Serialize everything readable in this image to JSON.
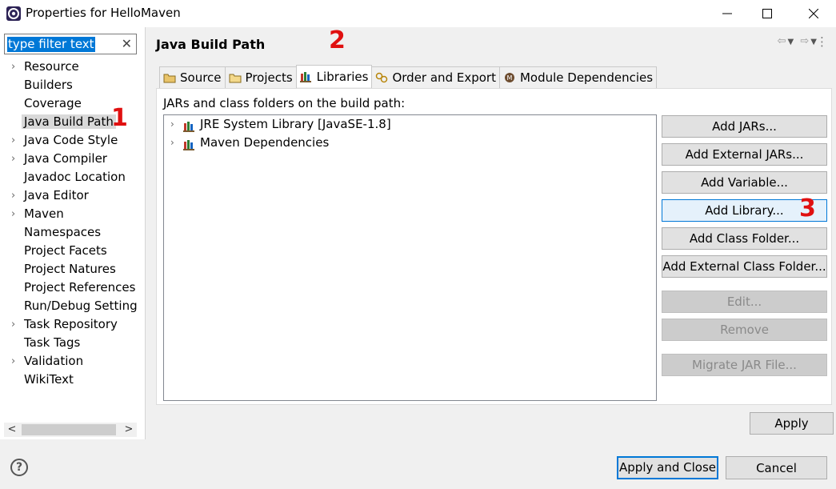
{
  "window": {
    "title": "Properties for HelloMaven",
    "minimize_glyph": "—",
    "maximize_glyph": "☐",
    "close_glyph": "✕"
  },
  "filter": {
    "value": "type filter text",
    "clear_glyph": "✕"
  },
  "nav": {
    "items": [
      {
        "label": "Resource",
        "expandable": true
      },
      {
        "label": "Builders",
        "expandable": false
      },
      {
        "label": "Coverage",
        "expandable": false
      },
      {
        "label": "Java Build Path",
        "expandable": false,
        "selected": true
      },
      {
        "label": "Java Code Style",
        "expandable": true
      },
      {
        "label": "Java Compiler",
        "expandable": true
      },
      {
        "label": "Javadoc Location",
        "expandable": false
      },
      {
        "label": "Java Editor",
        "expandable": true
      },
      {
        "label": "Maven",
        "expandable": true
      },
      {
        "label": "Namespaces",
        "expandable": false
      },
      {
        "label": "Project Facets",
        "expandable": false
      },
      {
        "label": "Project Natures",
        "expandable": false
      },
      {
        "label": "Project References",
        "expandable": false
      },
      {
        "label": "Run/Debug Setting",
        "expandable": false
      },
      {
        "label": "Task Repository",
        "expandable": true
      },
      {
        "label": "Task Tags",
        "expandable": false
      },
      {
        "label": "Validation",
        "expandable": true
      },
      {
        "label": "WikiText",
        "expandable": false
      }
    ]
  },
  "page": {
    "title": "Java Build Path",
    "tabs": [
      {
        "label": "Source",
        "icon": "source-folder-icon"
      },
      {
        "label": "Projects",
        "icon": "projects-folder-icon"
      },
      {
        "label": "Libraries",
        "icon": "libraries-icon",
        "active": true
      },
      {
        "label": "Order and Export",
        "icon": "order-export-icon"
      },
      {
        "label": "Module Dependencies",
        "icon": "module-icon"
      }
    ],
    "list_label": "JARs and class folders on the build path:",
    "libraries": [
      {
        "label": "JRE System Library [JavaSE-1.8]"
      },
      {
        "label": "Maven Dependencies"
      }
    ],
    "buttons": {
      "add_jars": "Add JARs...",
      "add_external_jars": "Add External JARs...",
      "add_variable": "Add Variable...",
      "add_library": "Add Library...",
      "add_class_folder": "Add Class Folder...",
      "add_external_class_folder": "Add External Class Folder...",
      "edit": "Edit...",
      "remove": "Remove",
      "migrate_jar": "Migrate JAR File..."
    },
    "apply": "Apply"
  },
  "footer": {
    "help_glyph": "?",
    "apply_and_close": "Apply and Close",
    "cancel": "Cancel"
  },
  "annotations": {
    "step1": "1",
    "step2": "2",
    "step3": "3",
    "color": "#e01010"
  }
}
